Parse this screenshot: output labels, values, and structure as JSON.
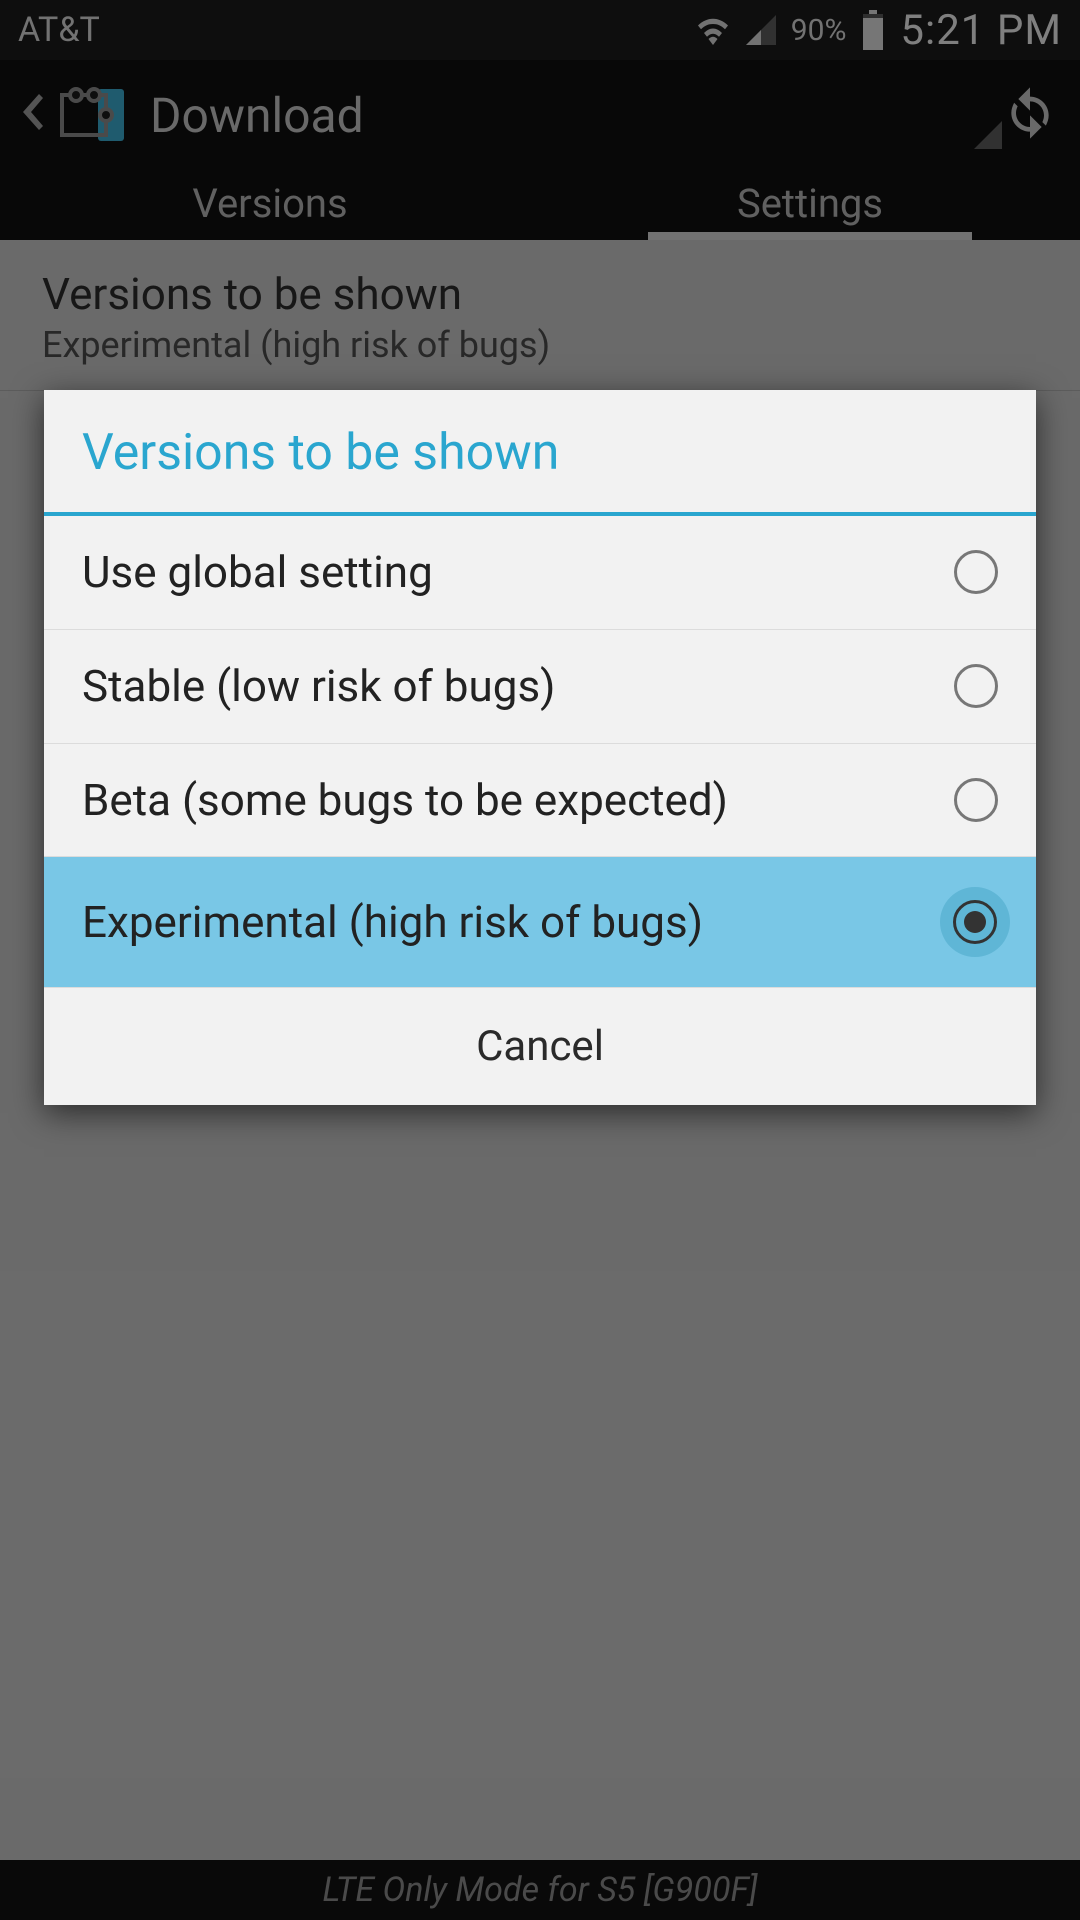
{
  "statusbar": {
    "carrier": "AT&T",
    "battery_pct": "90%",
    "clock": "5:21 PM"
  },
  "actionbar": {
    "title": "Download"
  },
  "tabs": {
    "versions": "Versions",
    "settings": "Settings",
    "active": "settings"
  },
  "pref": {
    "title": "Versions to be shown",
    "summary": "Experimental (high risk of bugs)"
  },
  "dialog": {
    "title": "Versions to be shown",
    "options": [
      {
        "label": "Use global setting",
        "selected": false
      },
      {
        "label": "Stable (low risk of bugs)",
        "selected": false
      },
      {
        "label": "Beta (some bugs to be expected)",
        "selected": false
      },
      {
        "label": "Experimental (high risk of bugs)",
        "selected": true
      }
    ],
    "cancel": "Cancel"
  },
  "bottom": {
    "text": "LTE Only Mode for S5 [G900F]"
  },
  "colors": {
    "accent": "#2aa6cf",
    "selection": "#79c7e6"
  }
}
